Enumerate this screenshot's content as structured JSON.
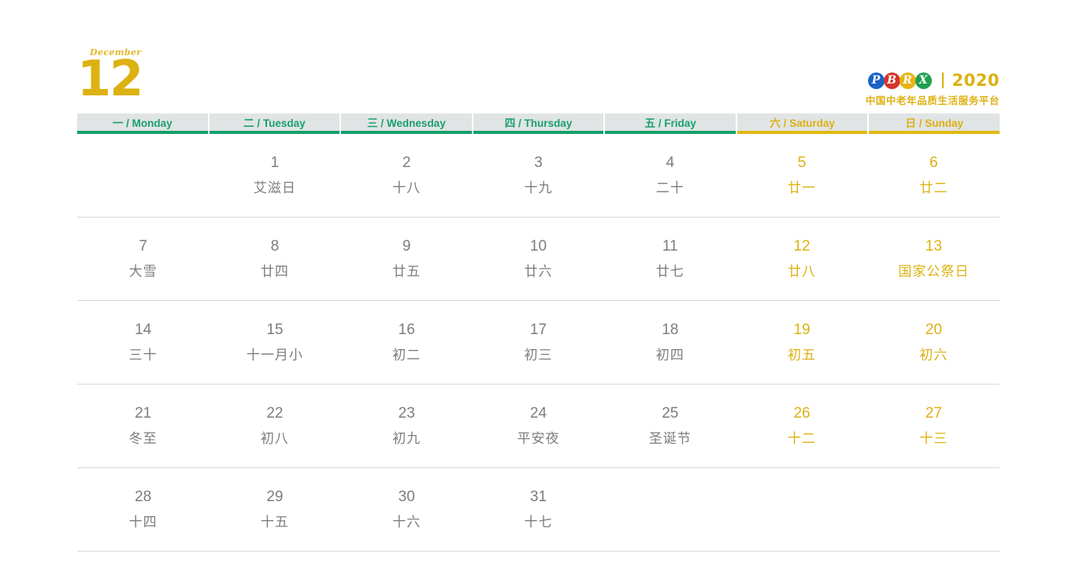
{
  "header": {
    "month_name": "December",
    "month_number": "12",
    "brand": {
      "logo_letters": [
        {
          "letter": "P",
          "color": "#1a62c8"
        },
        {
          "letter": "B",
          "color": "#d6352b"
        },
        {
          "letter": "R",
          "color": "#e8b515"
        },
        {
          "letter": "X",
          "color": "#1fa04f"
        }
      ],
      "year": "2020",
      "subtitle": "中国中老年品质生活服务平台"
    }
  },
  "colors": {
    "weekday_green": "#14a06b",
    "weekend_gold": "#ddb111",
    "header_bg": "#e0e4e4",
    "text_gray": "#7d7d7d",
    "row_line": "#d8d8d8"
  },
  "weekdays": [
    {
      "label": "一 / Monday",
      "type": "weekday"
    },
    {
      "label": "二 / Tuesday",
      "type": "weekday"
    },
    {
      "label": "三 / Wednesday",
      "type": "weekday"
    },
    {
      "label": "四 / Thursday",
      "type": "weekday"
    },
    {
      "label": "五 / Friday",
      "type": "weekday"
    },
    {
      "label": "六 / Saturday",
      "type": "weekend"
    },
    {
      "label": "日 / Sunday",
      "type": "weekend"
    }
  ],
  "weeks": [
    [
      {
        "day": "",
        "label": "",
        "type": "empty"
      },
      {
        "day": "1",
        "label": "艾滋日",
        "type": "weekday"
      },
      {
        "day": "2",
        "label": "十八",
        "type": "weekday"
      },
      {
        "day": "3",
        "label": "十九",
        "type": "weekday"
      },
      {
        "day": "4",
        "label": "二十",
        "type": "weekday"
      },
      {
        "day": "5",
        "label": "廿一",
        "type": "weekend"
      },
      {
        "day": "6",
        "label": "廿二",
        "type": "weekend"
      }
    ],
    [
      {
        "day": "7",
        "label": "大雪",
        "type": "weekday"
      },
      {
        "day": "8",
        "label": "廿四",
        "type": "weekday"
      },
      {
        "day": "9",
        "label": "廿五",
        "type": "weekday"
      },
      {
        "day": "10",
        "label": "廿六",
        "type": "weekday"
      },
      {
        "day": "11",
        "label": "廿七",
        "type": "weekday"
      },
      {
        "day": "12",
        "label": "廿八",
        "type": "weekend"
      },
      {
        "day": "13",
        "label": "国家公祭日",
        "type": "weekend"
      }
    ],
    [
      {
        "day": "14",
        "label": "三十",
        "type": "weekday"
      },
      {
        "day": "15",
        "label": "十一月小",
        "type": "weekday"
      },
      {
        "day": "16",
        "label": "初二",
        "type": "weekday"
      },
      {
        "day": "17",
        "label": "初三",
        "type": "weekday"
      },
      {
        "day": "18",
        "label": "初四",
        "type": "weekday"
      },
      {
        "day": "19",
        "label": "初五",
        "type": "weekend"
      },
      {
        "day": "20",
        "label": "初六",
        "type": "weekend"
      }
    ],
    [
      {
        "day": "21",
        "label": "冬至",
        "type": "weekday"
      },
      {
        "day": "22",
        "label": "初八",
        "type": "weekday"
      },
      {
        "day": "23",
        "label": "初九",
        "type": "weekday"
      },
      {
        "day": "24",
        "label": "平安夜",
        "type": "weekday"
      },
      {
        "day": "25",
        "label": "圣诞节",
        "type": "weekday"
      },
      {
        "day": "26",
        "label": "十二",
        "type": "weekend"
      },
      {
        "day": "27",
        "label": "十三",
        "type": "weekend"
      }
    ],
    [
      {
        "day": "28",
        "label": "十四",
        "type": "weekday"
      },
      {
        "day": "29",
        "label": "十五",
        "type": "weekday"
      },
      {
        "day": "30",
        "label": "十六",
        "type": "weekday"
      },
      {
        "day": "31",
        "label": "十七",
        "type": "weekday"
      },
      {
        "day": "",
        "label": "",
        "type": "empty"
      },
      {
        "day": "",
        "label": "",
        "type": "empty"
      },
      {
        "day": "",
        "label": "",
        "type": "empty"
      }
    ]
  ]
}
